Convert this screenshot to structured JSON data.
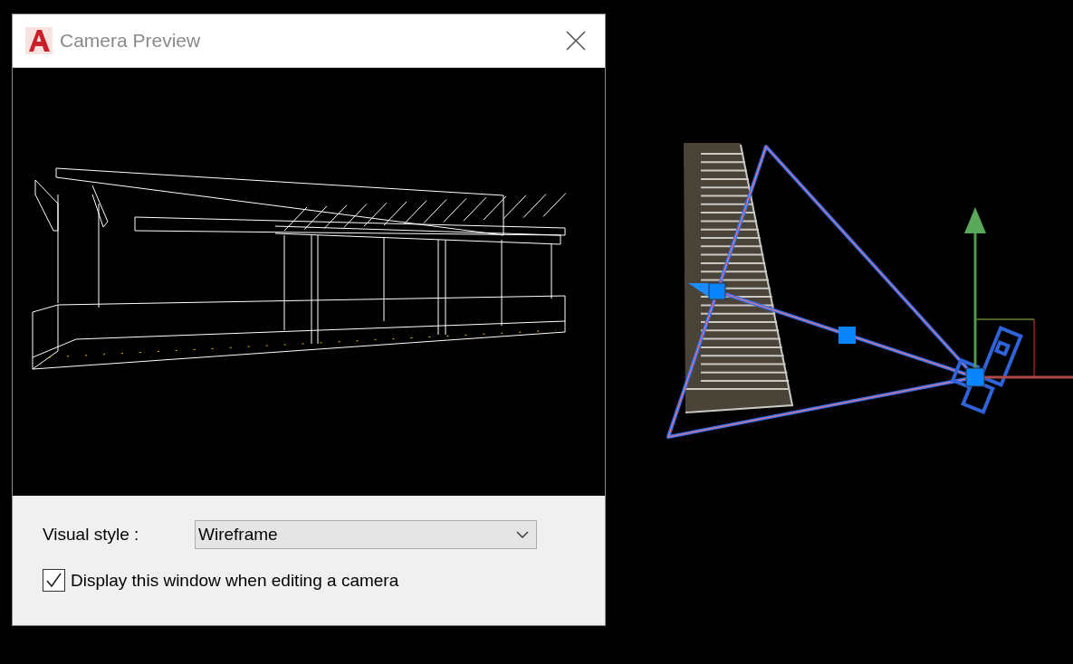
{
  "window": {
    "title": "Camera Preview"
  },
  "visual_style": {
    "label": "Visual style :",
    "value": "Wireframe"
  },
  "display_option": {
    "label": "Display this window when editing a camera",
    "checked": true
  }
}
